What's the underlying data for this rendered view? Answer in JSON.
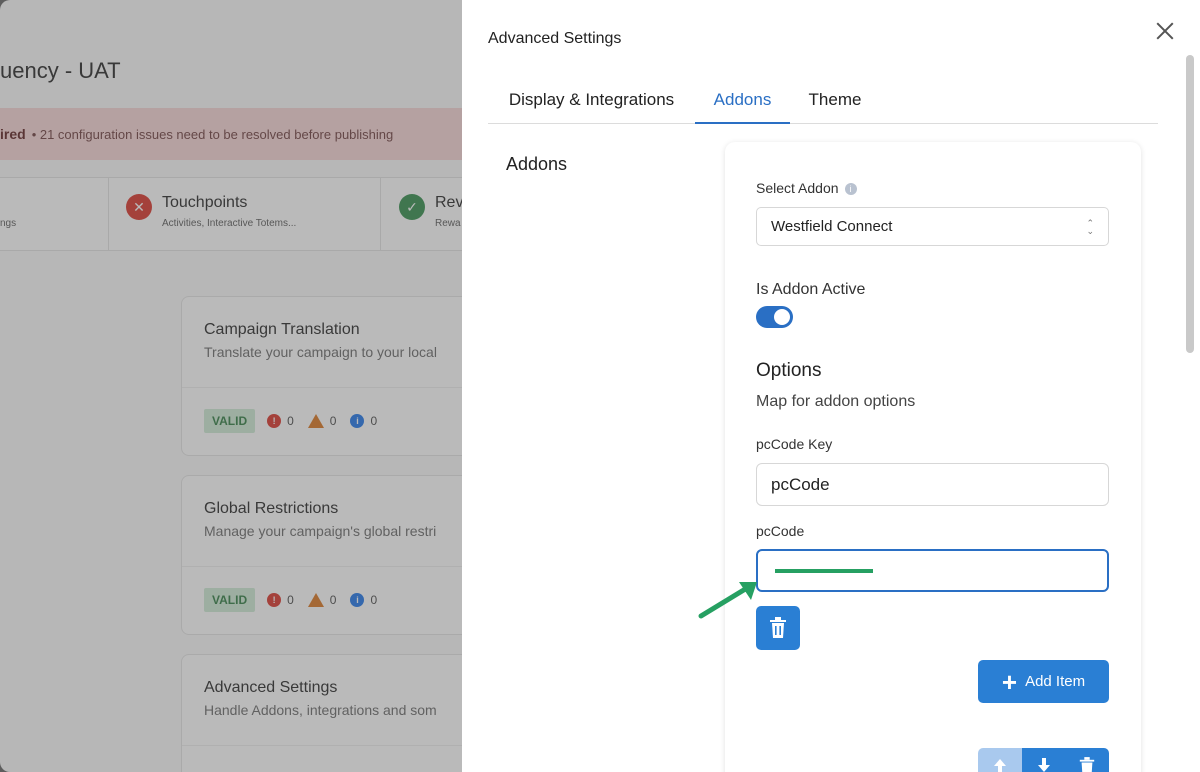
{
  "background": {
    "title": "uency - UAT",
    "banner_strong": "ired",
    "banner_message": "• 21 configuration issues need to be resolved before publishing",
    "steps": [
      {
        "title": "",
        "sub": "ngs"
      },
      {
        "title": "Touchpoints",
        "sub": "Activities, Interactive Totems..."
      },
      {
        "title": "Rev",
        "sub": "Rewa"
      }
    ],
    "cards": [
      {
        "title": "Campaign Translation",
        "subtitle": "Translate your campaign to your local",
        "status": "VALID",
        "errors": "0",
        "warnings": "0",
        "infos": "0"
      },
      {
        "title": "Global Restrictions",
        "subtitle": "Manage your campaign's global restri",
        "status": "VALID",
        "errors": "0",
        "warnings": "0",
        "infos": "0"
      },
      {
        "title": "Advanced Settings",
        "subtitle": "Handle Addons, integrations and som"
      }
    ]
  },
  "drawer": {
    "title": "Advanced Settings",
    "tabs": [
      {
        "label": "Display & Integrations"
      },
      {
        "label": "Addons"
      },
      {
        "label": "Theme"
      }
    ],
    "active_tab": "Addons",
    "section_title": "Addons",
    "select_addon_label": "Select Addon",
    "select_addon_value": "Westfield Connect",
    "is_active_label": "Is Addon Active",
    "is_active": true,
    "options_title": "Options",
    "options_subtitle": "Map for addon options",
    "pccode_key_label": "pcCode Key",
    "pccode_key_value": "pcCode",
    "pccode_label": "pcCode",
    "pccode_value": "",
    "add_item_label": "Add Item"
  },
  "colors": {
    "accent": "#2a7fd4",
    "tab_active": "#2a6fc4",
    "valid_bg": "#cdebd4",
    "error": "#d93025",
    "warning": "#d9731a",
    "annotation": "#26a062"
  }
}
